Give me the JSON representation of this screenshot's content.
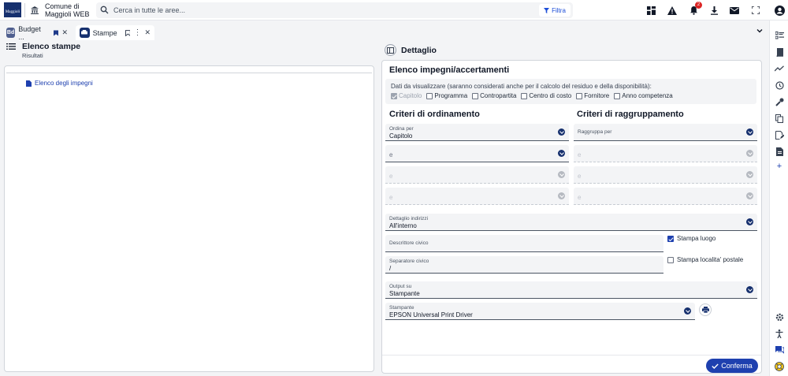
{
  "header": {
    "logo_text": "Maggioli",
    "app_title": "Comune di Maggioli WEB",
    "search_placeholder": "Cerca in tutte le aree...",
    "filter_label": "Filtra",
    "notifications_count": "2"
  },
  "tabs": [
    {
      "label": "Budget ...",
      "badge": "Bd"
    },
    {
      "label": "Stampe"
    }
  ],
  "left": {
    "title": "Elenco stampe",
    "subtitle": "Risultati",
    "tree_item": "Elenco degli impegni"
  },
  "right": {
    "title": "Dettaglio",
    "section_title": "Elenco impegni/accertamenti",
    "dati_label": "Dati da visualizzare (saranno considerati anche per il calcolo del residuo e della disponibilità):",
    "dati_options": [
      {
        "label": "Capitolo",
        "checked": true,
        "disabled": true
      },
      {
        "label": "Programma",
        "checked": false
      },
      {
        "label": "Contropartita",
        "checked": false
      },
      {
        "label": "Centro di costo",
        "checked": false
      },
      {
        "label": "Fornitore",
        "checked": false
      },
      {
        "label": "Anno competenza",
        "checked": false
      }
    ],
    "ordinamento_title": "Criteri di ordinamento",
    "raggruppamento_title": "Criteri di raggruppamento",
    "ordina_label": "Ordina per",
    "ordina_value": "Capitolo",
    "e1": "e",
    "e2": "e",
    "e3": "e",
    "raggruppa_label": "Raggruppa per",
    "r_e1": "e",
    "r_e2": "e",
    "r_e3": "e",
    "dettaglio_label": "Dettaglio indirizzi",
    "dettaglio_value": "All'interno",
    "descrittore_label": "Descrittore civico",
    "separatore_label": "Separatore civico",
    "separatore_value": "/",
    "stampa_luogo": "Stampa luogo",
    "stampa_localita": "Stampa localita' postale",
    "output_label": "Output su",
    "output_value": "Stampante",
    "stampante_label": "Stampante",
    "stampante_value": "EPSON Universal Print Driver",
    "confirm_label": "Conferma"
  },
  "colors": {
    "brand": "#16306e",
    "accent": "#1e40af",
    "tab_badge": "#4f5f8f"
  }
}
